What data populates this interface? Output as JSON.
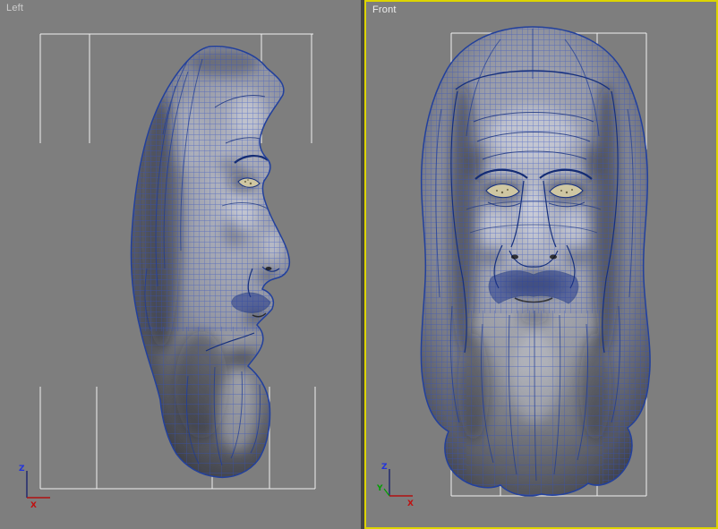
{
  "viewports": [
    {
      "label": "Left",
      "active": false,
      "axis_labels": {
        "z": "Z",
        "x": "X"
      }
    },
    {
      "label": "Front",
      "active": true,
      "axis_labels": {
        "z": "Z",
        "y": "Y",
        "x": "X"
      }
    }
  ],
  "colors": {
    "viewport_background": "#7e7e7e",
    "divider": "#454545",
    "active_viewport_outline": "#ddd400",
    "wireframe_blue": "#3352c4",
    "mesh_outline_blue": "#22409c",
    "reference_line_white": "#f0f0f0",
    "label_inactive": "#cdcdcd",
    "label_active": "#efefef",
    "axis_x_red": "#c01010",
    "axis_y_green": "#00a000",
    "axis_z_blue": "#2233dd"
  }
}
